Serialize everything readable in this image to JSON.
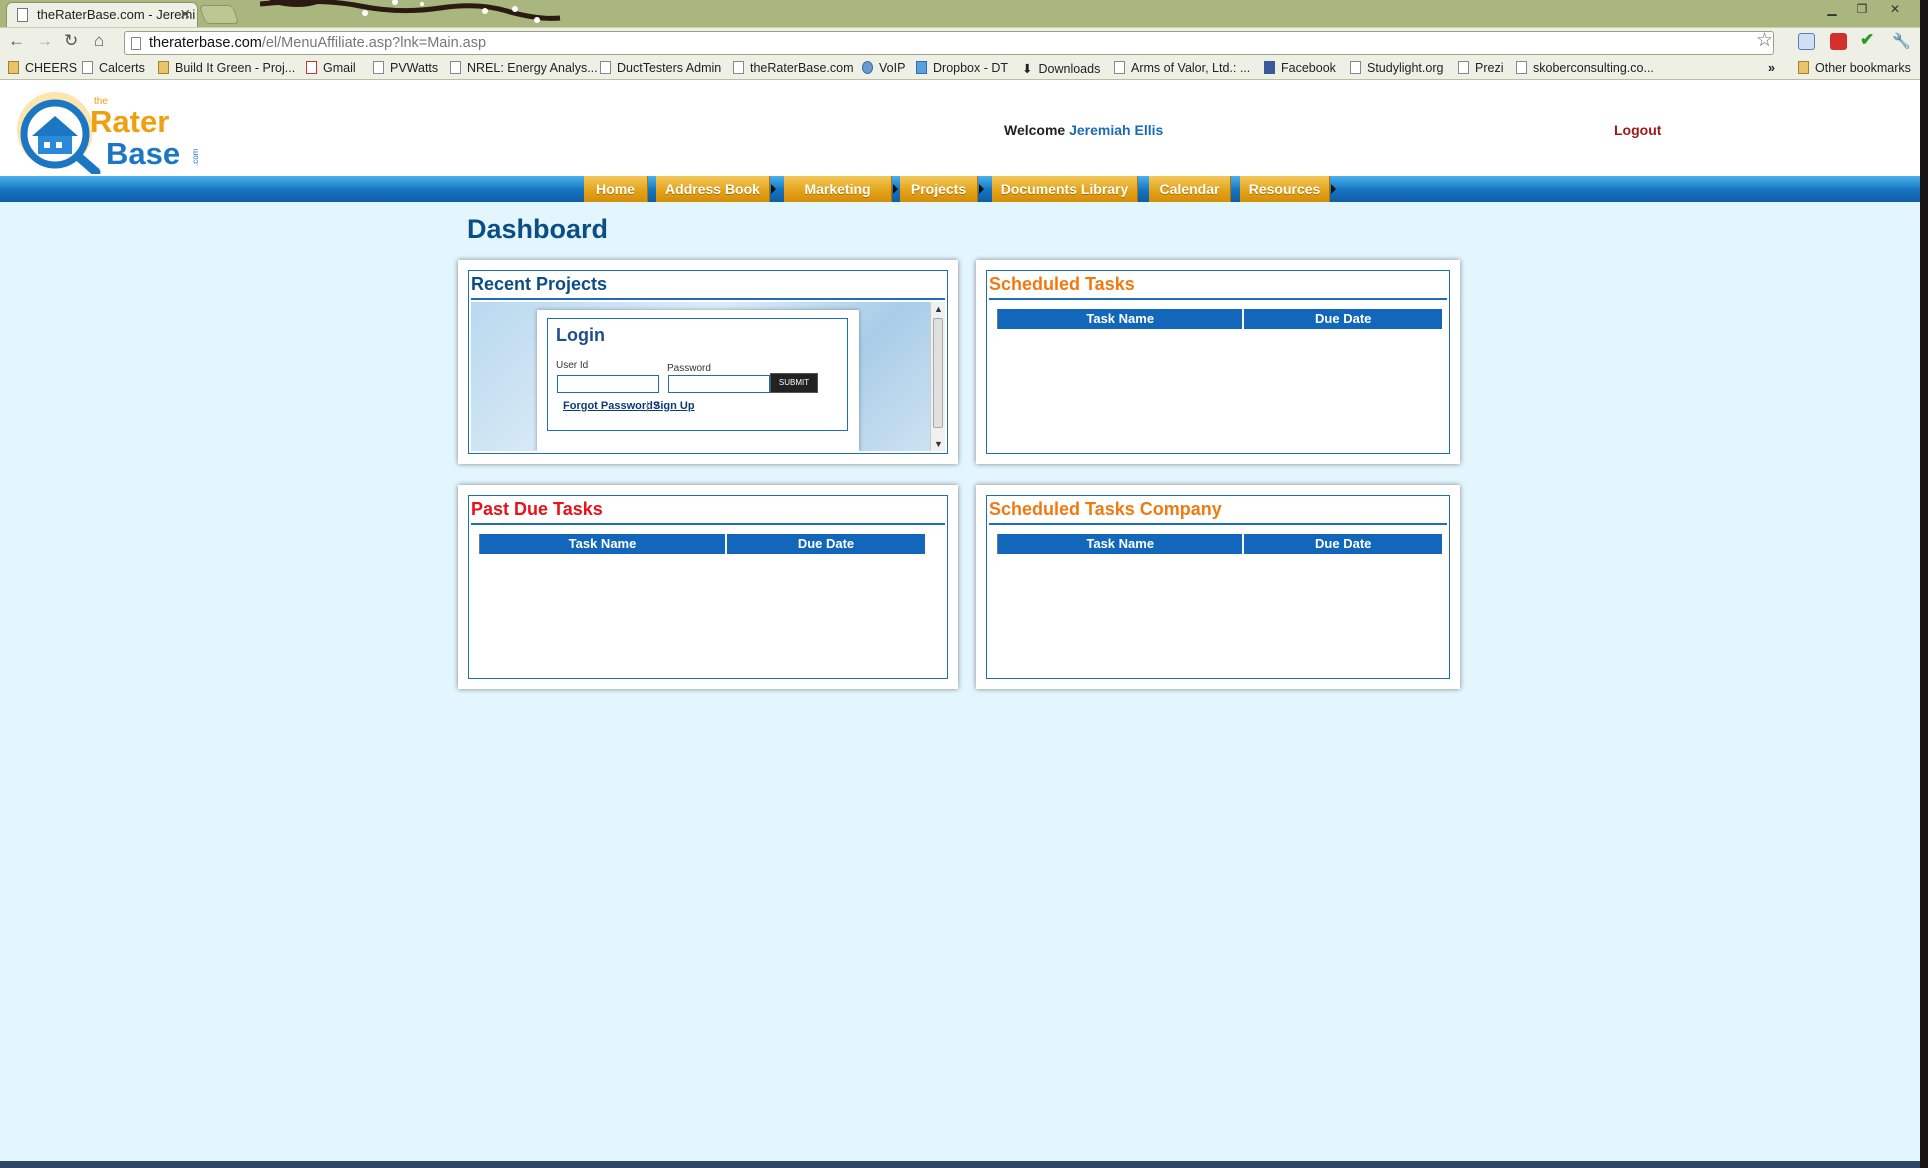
{
  "browser": {
    "tab_title": "theRaterBase.com - Jeremi",
    "url_domain": "theraterbase.com",
    "url_path": "/el/MenuAffiliate.asp?lnk=Main.asp",
    "bookmarks": [
      "CHEERS",
      "Calcerts",
      "Build It Green - Proj...",
      "Gmail",
      "PVWatts",
      "NREL: Energy Analys...",
      "DuctTesters Admin",
      "theRaterBase.com",
      "VoIP",
      "Dropbox - DT",
      "Downloads",
      "Arms of Valor, Ltd.: ...",
      "Facebook",
      "Studylight.org",
      "Prezi",
      "skoberconsulting.co..."
    ],
    "other_bookmarks": "Other bookmarks"
  },
  "header": {
    "logo_the": "the",
    "logo_rater": "Rater",
    "logo_base": "Base",
    "logo_com": ".com",
    "welcome_label": "Welcome",
    "user_name": "Jeremiah Ellis",
    "logout": "Logout"
  },
  "nav": [
    "Home",
    "Address Book",
    "Marketing",
    "Projects",
    "Documents Library",
    "Calendar",
    "Resources"
  ],
  "page_title": "Dashboard",
  "panels": {
    "recent_projects": {
      "title": "Recent Projects"
    },
    "scheduled_tasks": {
      "title": "Scheduled Tasks",
      "col1": "Task Name",
      "col2": "Due Date"
    },
    "past_due_tasks": {
      "title": "Past Due Tasks",
      "col1": "Task Name",
      "col2": "Due Date"
    },
    "scheduled_tasks_company": {
      "title": "Scheduled Tasks Company",
      "col1": "Task Name",
      "col2": "Due Date"
    }
  },
  "login": {
    "title": "Login",
    "user_label": "User Id",
    "password_label": "Password",
    "submit": "SUBMIT",
    "forgot": "Forgot Password?",
    "separator": "|",
    "signup": "Sign Up"
  },
  "colors": {
    "accent_blue": "#1267bb",
    "orange": "#f07a12",
    "red": "#e8121a",
    "title_blue": "#0b4e86"
  }
}
